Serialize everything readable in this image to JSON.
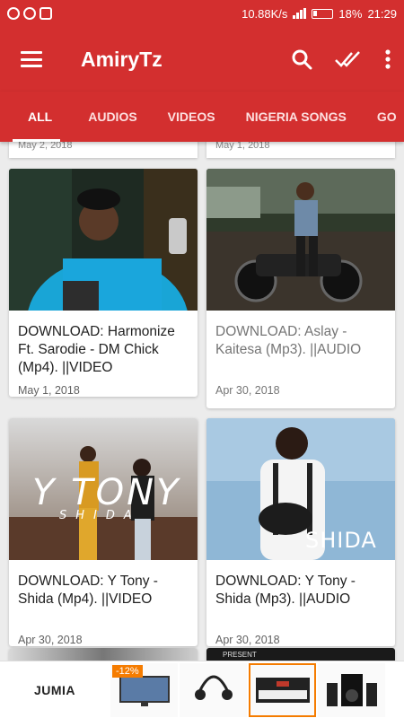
{
  "status": {
    "speed": "10.88K/s",
    "battery": "18%",
    "time": "21:29"
  },
  "app": {
    "title": "AmiryTz"
  },
  "tabs": [
    "ALL",
    "AUDIOS",
    "VIDEOS",
    "NIGERIA SONGS",
    "GO"
  ],
  "posts": [
    {
      "title": "DOWNLOAD: Harmonize Ft. Sarodie - DM Chick (Mp4). ||VIDEO",
      "date": "May 1, 2018"
    },
    {
      "title": "DOWNLOAD: Aslay - Kaitesa (Mp3). ||AUDIO",
      "date": "Apr 30, 2018"
    },
    {
      "title": "DOWNLOAD: Y Tony - Shida (Mp4). ||VIDEO",
      "date": "Apr 30, 2018"
    },
    {
      "title": "DOWNLOAD: Y Tony - Shida (Mp3). ||AUDIO",
      "date": "Apr 30, 2018"
    }
  ],
  "previous": {
    "left_date": "May 2, 2018",
    "right_date": "May 1, 2018"
  },
  "artwork": {
    "ytony_title": "Y TONY",
    "ytony_sub": "SHIDA",
    "shida": "SHIDA",
    "present": "PRESENT"
  },
  "ad": {
    "brand": "JUMIA",
    "discount": "-12%"
  }
}
